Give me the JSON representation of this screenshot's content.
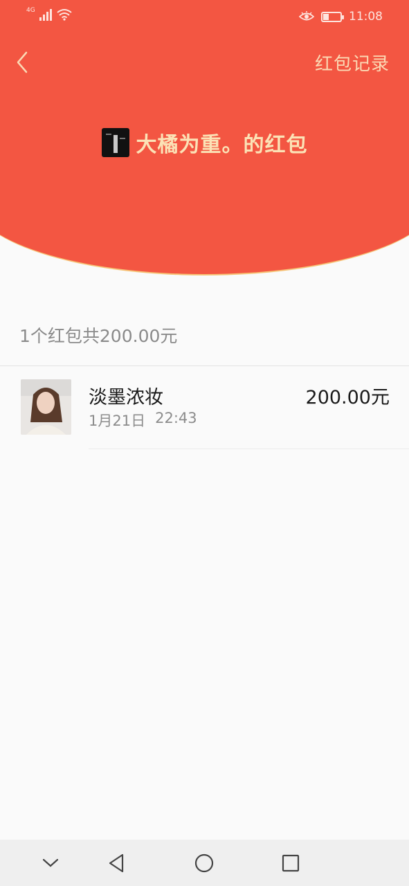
{
  "status_bar": {
    "network": "4G",
    "time": "11:08",
    "battery_level": 0.3
  },
  "header": {
    "records_label": "红包记录",
    "sender_title": "大橘为重。的红包"
  },
  "summary": {
    "text": "1个红包共200.00元"
  },
  "records": [
    {
      "name": "淡墨浓妆",
      "date": "1月21日",
      "time": "22:43",
      "amount": "200.00元"
    }
  ],
  "colors": {
    "header_red": "#f35642",
    "gold_text": "#fbe2b6",
    "background": "#fafafa"
  },
  "icons": {
    "back": "back-arrow-icon",
    "eye": "eye-icon",
    "nav_down": "chevron-down-icon",
    "nav_back": "triangle-back-icon",
    "nav_home": "circle-home-icon",
    "nav_recent": "square-recent-icon"
  }
}
